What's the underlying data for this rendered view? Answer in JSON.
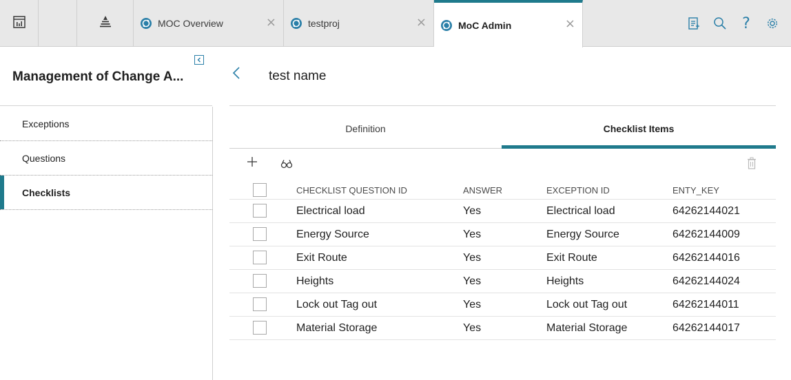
{
  "tabs": [
    {
      "label": "MOC Overview",
      "active": false
    },
    {
      "label": "testproj",
      "active": false
    },
    {
      "label": "MoC Admin",
      "active": true
    }
  ],
  "topbar_icons": [
    "dashboard-icon",
    "hierarchy-icon",
    "notes-icon",
    "search-icon",
    "help-icon",
    "settings-icon"
  ],
  "left_panel": {
    "title": "Management of Change A...",
    "nav_items": [
      {
        "label": "Exceptions",
        "active": false
      },
      {
        "label": "Questions",
        "active": false
      },
      {
        "label": "Checklists",
        "active": true
      }
    ]
  },
  "record": {
    "title": "test name"
  },
  "subtabs": [
    {
      "label": "Definition",
      "active": false
    },
    {
      "label": "Checklist Items",
      "active": true
    }
  ],
  "grid": {
    "columns": [
      "CHECKLIST QUESTION ID",
      "ANSWER",
      "EXCEPTION ID",
      "ENTY_KEY"
    ],
    "rows": [
      {
        "question": "Electrical load",
        "answer": "Yes",
        "exception": "Electrical load",
        "key": "64262144021"
      },
      {
        "question": "Energy Source",
        "answer": "Yes",
        "exception": "Energy Source",
        "key": "64262144009"
      },
      {
        "question": "Exit Route",
        "answer": "Yes",
        "exception": "Exit Route",
        "key": "64262144016"
      },
      {
        "question": "Heights",
        "answer": "Yes",
        "exception": "Heights",
        "key": "64262144024"
      },
      {
        "question": "Lock out Tag out",
        "answer": "Yes",
        "exception": "Lock out Tag out",
        "key": "64262144011"
      },
      {
        "question": "Material Storage",
        "answer": "Yes",
        "exception": "Material Storage",
        "key": "64262144017"
      }
    ]
  },
  "colors": {
    "accent": "#1f7a8c",
    "topbar_bg": "#e8e8e8",
    "icon_blue": "#2a7fa8"
  }
}
